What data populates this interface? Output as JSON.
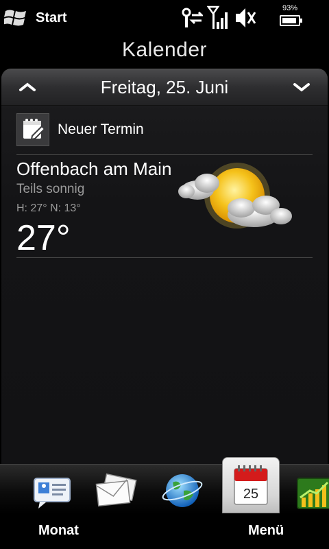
{
  "status_bar": {
    "start_label": "Start",
    "battery_percent": "93%",
    "battery_level": 0.93,
    "icons": [
      "windows-flag-icon",
      "data-sync-icon",
      "signal-strength-icon",
      "speaker-muted-icon",
      "battery-icon"
    ]
  },
  "title": "Kalender",
  "date_header": {
    "date": "Freitag, 25. Juni",
    "prev_icon": "chevron-up-icon",
    "next_icon": "chevron-down-icon"
  },
  "new_appointment": {
    "label": "Neuer Termin",
    "icon": "notepad-pen-icon"
  },
  "weather": {
    "city": "Offenbach am Main",
    "condition": "Teils sonnig",
    "high_low": "H: 27° N: 13°",
    "temperature": "27°",
    "icon": "partly-sunny-icon"
  },
  "tabs": [
    {
      "name": "contacts",
      "icon": "contact-card-icon"
    },
    {
      "name": "mail",
      "icon": "envelopes-icon"
    },
    {
      "name": "internet",
      "icon": "globe-icon"
    },
    {
      "name": "calendar",
      "icon": "calendar-icon",
      "day": "25",
      "active": true
    },
    {
      "name": "stocks",
      "icon": "stocks-chart-icon"
    }
  ],
  "softkeys": {
    "left": "Monat",
    "right": "Menü"
  }
}
